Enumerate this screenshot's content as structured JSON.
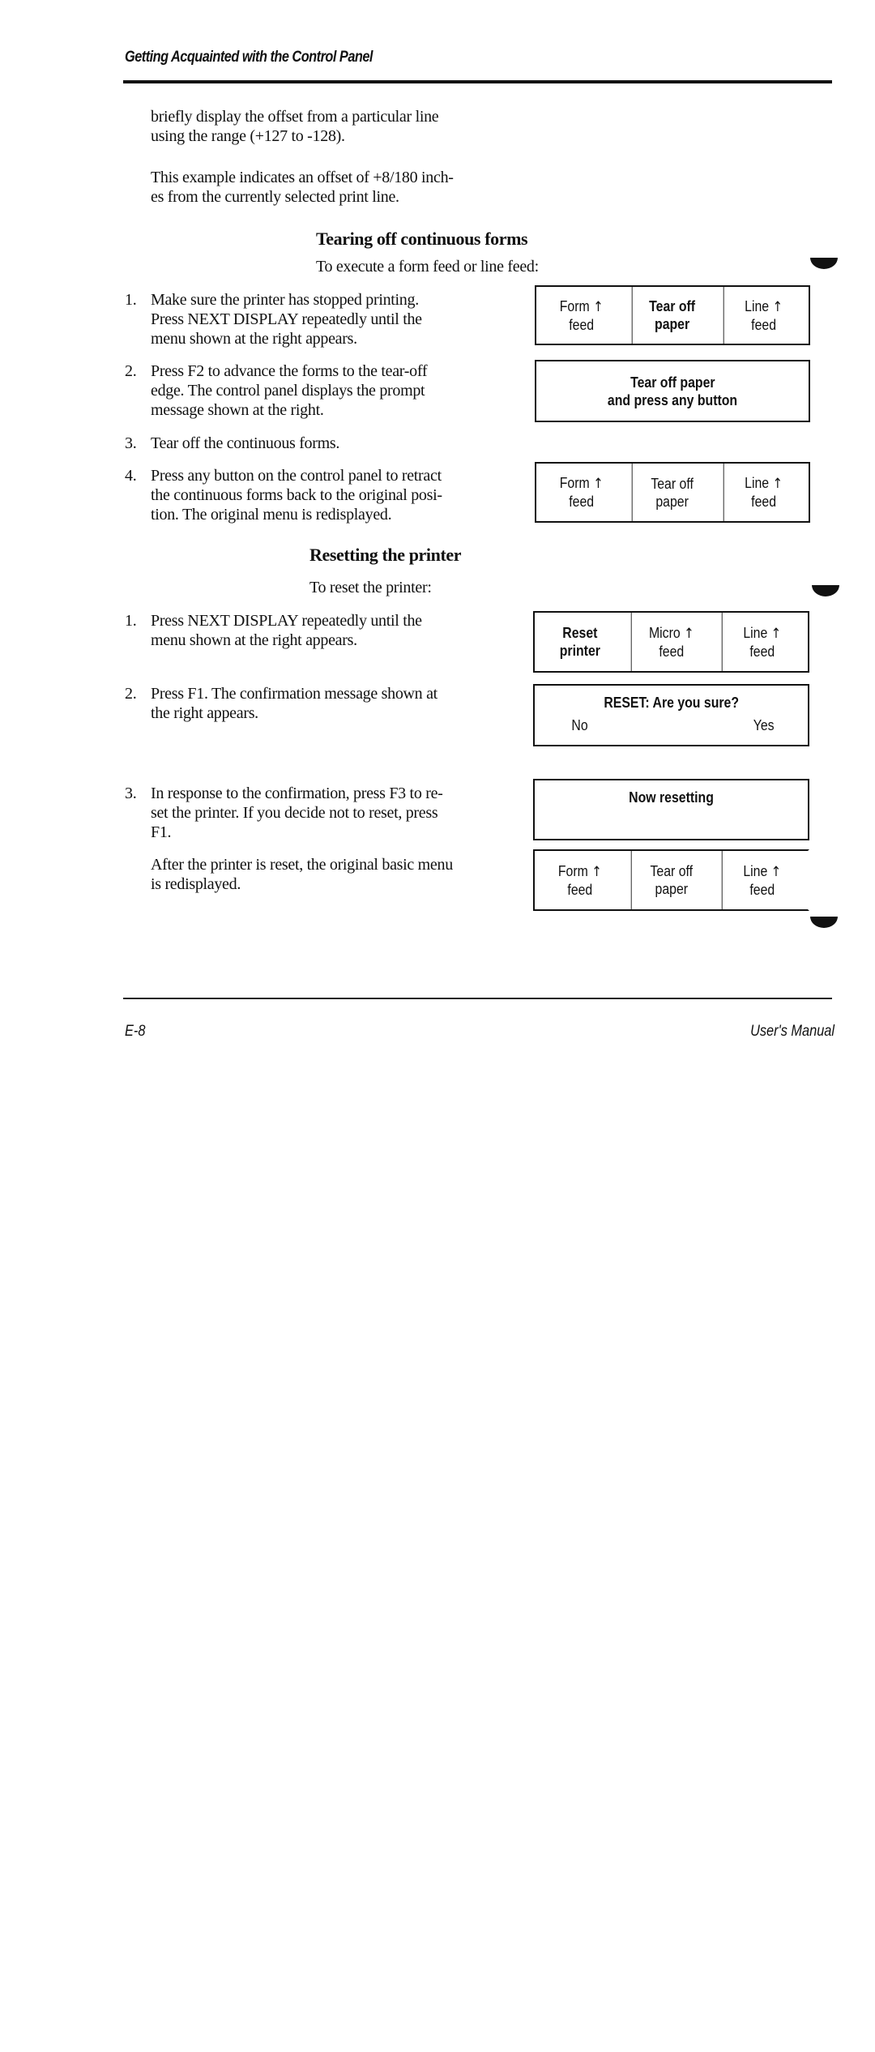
{
  "header": {
    "running_head": "Getting Acquainted with the Control Panel"
  },
  "intro_paragraphs": [
    [
      "briefly display the offset from a particular line",
      "using the range (+127 to -128)."
    ],
    [
      "This example indicates an offset of +8/180 inch-",
      "es from the currently selected print line."
    ]
  ],
  "sections": [
    {
      "heading": "Tearing off continuous forms",
      "intro": "To execute a form feed or line feed:",
      "steps": [
        {
          "num": "1.",
          "lines": [
            "Make sure the printer has stopped printing.",
            "Press NEXT DISPLAY repeatedly until the",
            "menu shown at the right appears."
          ]
        },
        {
          "num": "2.",
          "lines": [
            "Press F2 to advance the forms to the tear-off",
            "edge. The control panel displays the prompt",
            "message shown at the right."
          ]
        },
        {
          "num": "3.",
          "lines": [
            "Tear off the continuous forms."
          ]
        },
        {
          "num": "4.",
          "lines": [
            "Press any button on the control panel to retract",
            "the continuous forms back to the original posi-",
            "tion. The original menu is redisplayed."
          ]
        }
      ],
      "panels": [
        {
          "type": "menu",
          "cells": [
            {
              "line1": "Form",
              "arrow": "↑",
              "line2": "feed",
              "bold": false
            },
            {
              "line1": "Tear off",
              "arrow": "",
              "line2": "paper",
              "bold": true
            },
            {
              "line1": "Line",
              "arrow": "↑",
              "line2": "feed",
              "bold": false
            }
          ]
        },
        {
          "type": "message",
          "lines": [
            "Tear off paper",
            "and press any button"
          ]
        },
        {
          "type": "menu",
          "cells": [
            {
              "line1": "Form",
              "arrow": "↑",
              "line2": "feed",
              "bold": false
            },
            {
              "line1": "Tear off",
              "arrow": "",
              "line2": "paper",
              "bold": false
            },
            {
              "line1": "Line",
              "arrow": "↑",
              "line2": "feed",
              "bold": false
            }
          ]
        }
      ]
    },
    {
      "heading": "Resetting the printer",
      "intro": "To reset the printer:",
      "steps": [
        {
          "num": "1.",
          "lines": [
            "Press NEXT DISPLAY repeatedly until the",
            "menu shown at the right appears."
          ]
        },
        {
          "num": "2.",
          "lines": [
            "Press F1. The confirmation message shown at",
            "the right appears."
          ]
        },
        {
          "num": "3.",
          "lines": [
            "In response to the confirmation, press F3 to re-",
            "set the printer. If you decide not to reset, press",
            "F1."
          ]
        }
      ],
      "note": [
        "After the printer is reset, the original basic menu",
        "is redisplayed."
      ],
      "panels": [
        {
          "type": "menu",
          "cells": [
            {
              "line1": "Reset",
              "arrow": "",
              "line2": "printer",
              "bold": true
            },
            {
              "line1": "Micro",
              "arrow": "↑",
              "line2": "feed",
              "bold": false
            },
            {
              "line1": "Line",
              "arrow": "↑",
              "line2": "feed",
              "bold": false
            }
          ]
        },
        {
          "type": "confirm",
          "title": "RESET: Are you sure?",
          "left": "No",
          "right": "Yes"
        },
        {
          "type": "message",
          "lines": [
            "Now resetting"
          ]
        },
        {
          "type": "menu",
          "cells": [
            {
              "line1": "Form",
              "arrow": "↑",
              "line2": "feed",
              "bold": false
            },
            {
              "line1": "Tear off",
              "arrow": "",
              "line2": "paper",
              "bold": false
            },
            {
              "line1": "Line",
              "arrow": "↑",
              "line2": "feed",
              "bold": false
            }
          ]
        }
      ]
    }
  ],
  "footer": {
    "page_number": "E-8",
    "manual_title": "User's Manual"
  }
}
